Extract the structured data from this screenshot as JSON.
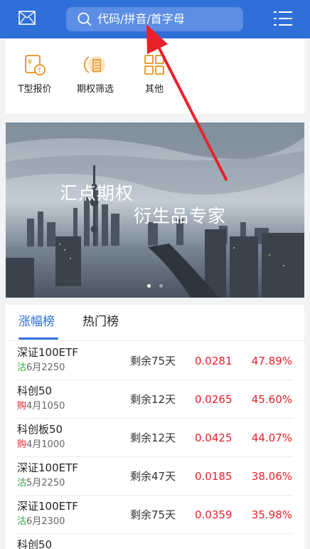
{
  "topbar": {
    "search_placeholder": "代码/拼音/首字母",
    "bg_color": "#2f6fd8"
  },
  "shortcuts": [
    {
      "label": "T型报价",
      "icon": "yen-t-quote-icon"
    },
    {
      "label": "期权筛选",
      "icon": "option-filter-icon"
    },
    {
      "label": "其他",
      "icon": "grid-more-icon"
    }
  ],
  "banner": {
    "title": "汇点期权",
    "subtitle": "衍生品专家",
    "carousel_index": 1,
    "carousel_count": 2
  },
  "tabs": [
    {
      "label": "涨幅榜",
      "active": true
    },
    {
      "label": "热门榜",
      "active": false
    }
  ],
  "rows": [
    {
      "name": "深证100ETF",
      "tag": "沽",
      "tag_color": "#2eaa3f",
      "contract": "6月2250",
      "days": "剩余75天",
      "price": "0.0281",
      "change": "47.89%"
    },
    {
      "name": "科创50",
      "tag": "购",
      "tag_color": "#e8212b",
      "contract": "4月1050",
      "days": "剩余12天",
      "price": "0.0265",
      "change": "45.60%"
    },
    {
      "name": "科创板50",
      "tag": "购",
      "tag_color": "#e8212b",
      "contract": "4月1000",
      "days": "剩余12天",
      "price": "0.0425",
      "change": "44.07%"
    },
    {
      "name": "深证100ETF",
      "tag": "沽",
      "tag_color": "#2eaa3f",
      "contract": "5月2250",
      "days": "剩余47天",
      "price": "0.0185",
      "change": "38.06%"
    },
    {
      "name": "深证100ETF",
      "tag": "沽",
      "tag_color": "#2eaa3f",
      "contract": "6月2300",
      "days": "剩余75天",
      "price": "0.0359",
      "change": "35.98%"
    },
    {
      "name": "科创50",
      "tag": "",
      "tag_color": "#e8212b",
      "contract": "",
      "days": "",
      "price": "",
      "change": ""
    }
  ],
  "colors": {
    "rise": "#e8212b",
    "accent": "#2f6fd8"
  }
}
